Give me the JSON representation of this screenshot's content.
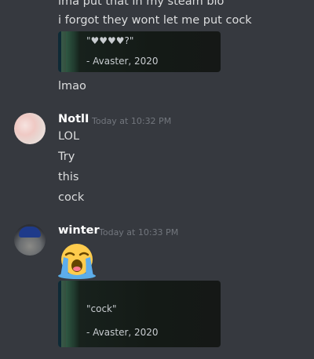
{
  "messages_top": {
    "line1": "ima put that in my steam bio",
    "line2": "i forgot they wont let me put cock",
    "embed1": {
      "quote": "\"♥♥♥♥?\"",
      "author": "- Avaster, 2020"
    },
    "line3": "lmao"
  },
  "message_notll": {
    "username": "NotlI",
    "timestamp": "Today at 10:32 PM",
    "lines": [
      "LOL",
      "Try",
      "this",
      "cock"
    ]
  },
  "message_winter": {
    "username": "winter",
    "timestamp": "Today at 10:33 PM",
    "emoji": "loudly-crying-face",
    "embed": {
      "quote": "\"cock\"",
      "author": "- Avaster, 2020"
    }
  },
  "colors": {
    "background": "#36393f",
    "text": "#dcddde",
    "username": "#ffffff",
    "timestamp": "#72767d",
    "embed_bar": "#0e2a36"
  }
}
